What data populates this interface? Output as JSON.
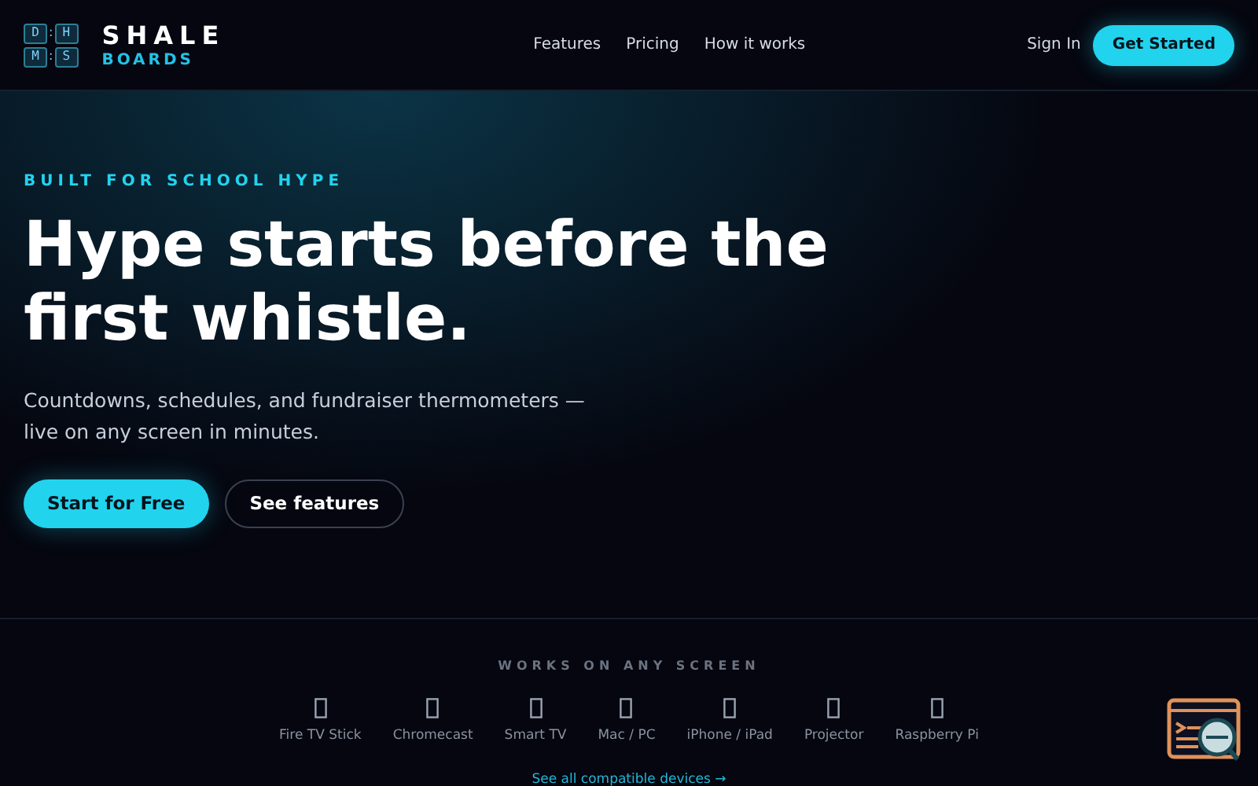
{
  "logo": {
    "keys": [
      "D",
      "H",
      "M",
      "S"
    ],
    "separator": ":",
    "name": "SHALE",
    "sub": "BOARDS"
  },
  "nav": {
    "links": [
      "Features",
      "Pricing",
      "How it works"
    ],
    "sign_in": "Sign In",
    "cta": "Get Started"
  },
  "hero": {
    "eyebrow": "BUILT FOR SCHOOL HYPE",
    "title": "Hype starts before the first whistle.",
    "subtitle": "Countdowns, schedules, and fundraiser thermometers — live on any screen in minutes.",
    "primary": "Start for Free",
    "secondary": "See features"
  },
  "devices": {
    "heading": "WORKS ON ANY SCREEN",
    "items": [
      "Fire TV Stick",
      "Chromecast",
      "Smart TV",
      "Mac / PC",
      "iPhone / iPad",
      "Projector",
      "Raspberry Pi"
    ],
    "link": "See all compatible devices →"
  }
}
